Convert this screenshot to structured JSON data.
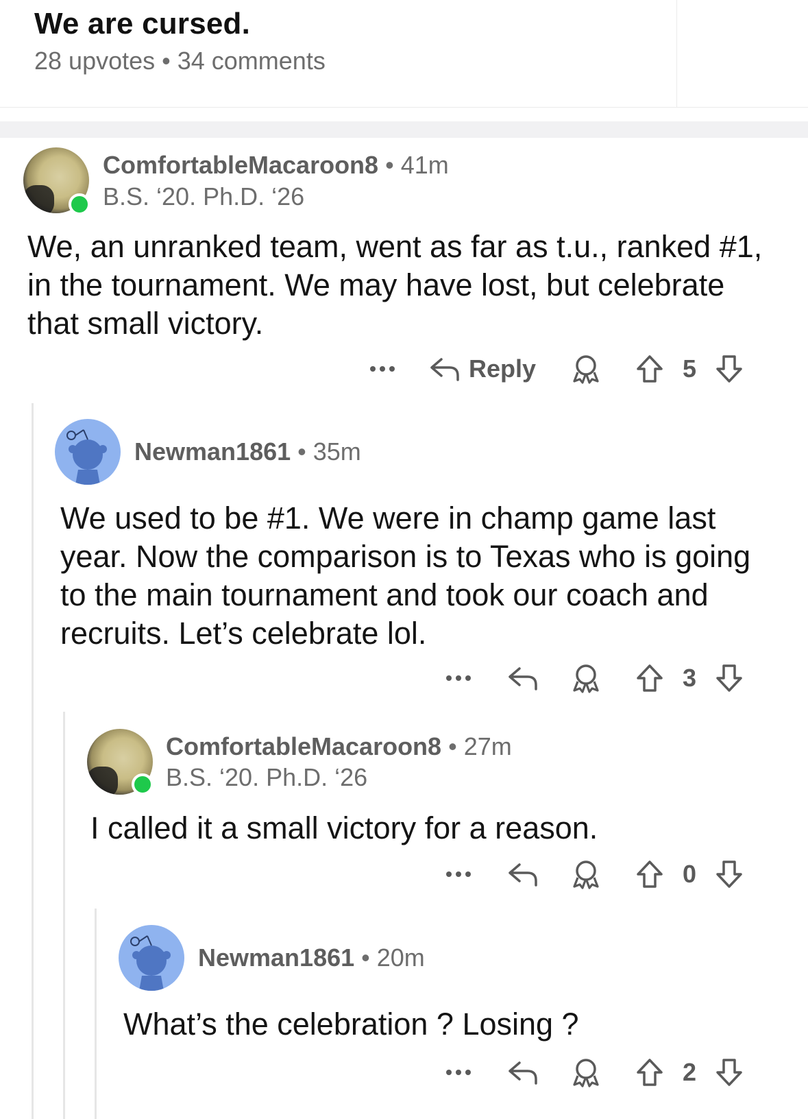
{
  "post": {
    "title": "We are cursed.",
    "meta": "28 upvotes • 34 comments"
  },
  "comments": [
    {
      "username": "ComfortableMacaroon8",
      "time": "41m",
      "flair": "B.S. ‘20. Ph.D. ‘26",
      "body": "We, an unranked team, went as far as t.u., ranked #1, in the tournament. We may have lost, but celebrate that small victory.",
      "reply_label": "Reply",
      "votes": "5",
      "online": true
    },
    {
      "username": "Newman1861",
      "time": "35m",
      "body": "We used to be #1.  We were in champ game last year.  Now the comparison is to Texas who is going to the main tournament and took our coach and recruits.  Let’s celebrate lol.",
      "votes": "3"
    },
    {
      "username": "ComfortableMacaroon8",
      "time": "27m",
      "flair": "B.S. ‘20. Ph.D. ‘26",
      "body": "I called it a small victory for a reason.",
      "votes": "0",
      "online": true
    },
    {
      "username": "Newman1861",
      "time": "20m",
      "body": "What’s the celebration ? Losing ?",
      "votes": "2"
    }
  ],
  "icons": {
    "more": "more-options-icon",
    "reply": "reply-arrow-icon",
    "award": "award-icon",
    "upvote": "upvote-arrow-icon",
    "downvote": "downvote-arrow-icon"
  },
  "colors": {
    "online": "#1ec94b",
    "snoo_avatar_bg": "#8fb3ef",
    "meta_text": "#6d6d6d"
  }
}
